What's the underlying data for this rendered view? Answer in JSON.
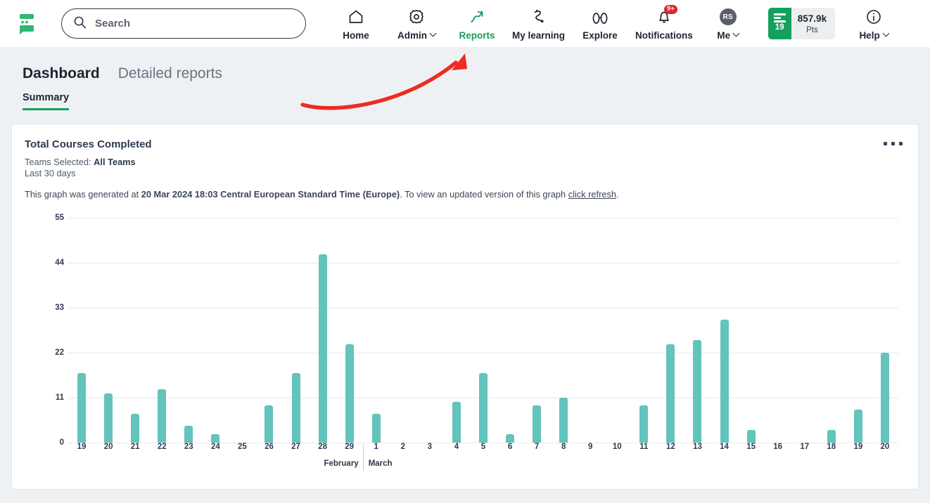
{
  "topnav": {
    "logo_name": "app-logo",
    "search": {
      "placeholder": "Search",
      "value": ""
    },
    "items": [
      {
        "label": "Home",
        "icon": "home-icon",
        "caret": false,
        "active": false
      },
      {
        "label": "Admin",
        "icon": "gear-icon",
        "caret": true,
        "active": false
      },
      {
        "label": "Reports",
        "icon": "trending-up-icon",
        "caret": false,
        "active": true
      },
      {
        "label": "My learning",
        "icon": "learning-path-icon",
        "caret": false,
        "active": false
      },
      {
        "label": "Explore",
        "icon": "binoculars-icon",
        "caret": false,
        "active": false
      },
      {
        "label": "Notifications",
        "icon": "bell-icon",
        "caret": false,
        "active": false,
        "badge": "9+"
      },
      {
        "label": "Me",
        "icon": "avatar-icon",
        "caret": true,
        "active": false,
        "avatar_initials": "RS"
      }
    ],
    "points": {
      "level": "19",
      "value": "857.9k",
      "unit": "Pts"
    },
    "help": {
      "label": "Help",
      "icon": "info-icon",
      "caret": true
    }
  },
  "page": {
    "tabs": [
      {
        "label": "Dashboard",
        "active": true
      },
      {
        "label": "Detailed reports",
        "active": false
      }
    ],
    "subtabs": [
      {
        "label": "Summary",
        "active": true
      }
    ],
    "annotation": {
      "name": "red-curved-arrow",
      "color": "#ef2b22",
      "points_to": "Reports"
    }
  },
  "card": {
    "title": "Total Courses Completed",
    "teams_label": "Teams Selected:",
    "teams_value": "All Teams",
    "range": "Last 30 days",
    "note_prefix": "This graph was generated at ",
    "note_timestamp": "20 Mar 2024 18:03 Central European Standard Time (Europe)",
    "note_middle": ". To view an updated version of this graph ",
    "note_link": "click refresh",
    "note_suffix": ".",
    "menu_icon": "kebab-menu-icon"
  },
  "chart_data": {
    "type": "bar",
    "title": "Total Courses Completed",
    "xlabel": "",
    "ylabel": "",
    "ylim": [
      0,
      55
    ],
    "yticks": [
      0,
      11,
      22,
      33,
      44,
      55
    ],
    "grid": true,
    "legend": false,
    "bar_color": "#63c3bd",
    "months": [
      {
        "name": "February",
        "count": 11
      },
      {
        "name": "March",
        "count": 20
      }
    ],
    "categories": [
      "19",
      "20",
      "21",
      "22",
      "23",
      "24",
      "25",
      "26",
      "27",
      "28",
      "29",
      "1",
      "2",
      "3",
      "4",
      "5",
      "6",
      "7",
      "8",
      "9",
      "10",
      "11",
      "12",
      "13",
      "14",
      "15",
      "16",
      "17",
      "18",
      "19",
      "20"
    ],
    "values": [
      17,
      12,
      7,
      13,
      4,
      2,
      0,
      9,
      17,
      46,
      24,
      7,
      0,
      0,
      10,
      17,
      2,
      9,
      11,
      0,
      0,
      9,
      24,
      25,
      30,
      3,
      0,
      0,
      3,
      8,
      22
    ]
  }
}
